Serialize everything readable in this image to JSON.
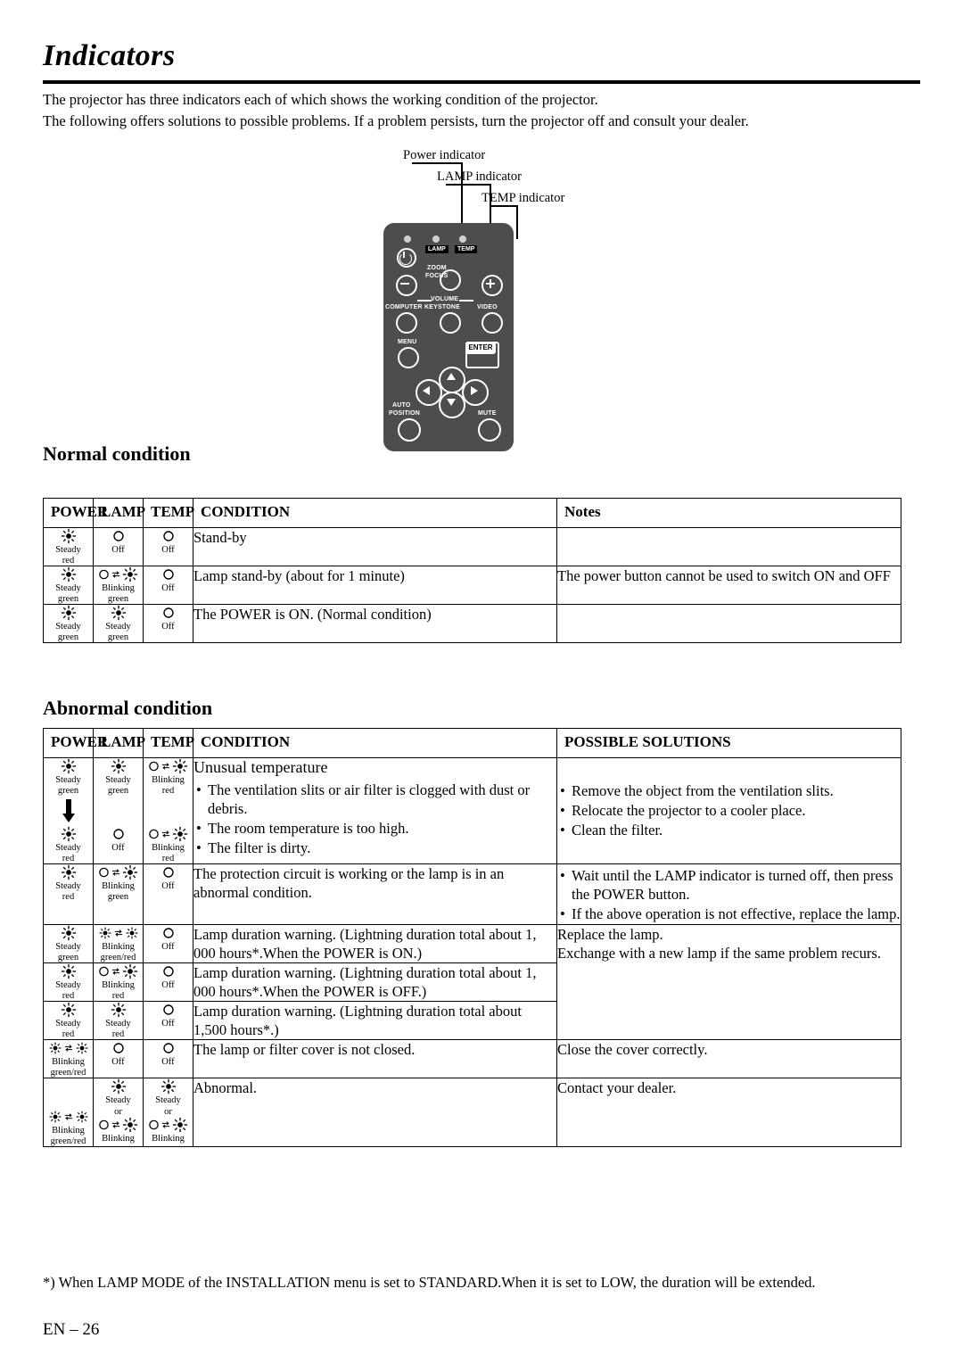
{
  "page": {
    "title": "Indicators",
    "intro_line1": "The projector has three indicators each of which shows the working condition of the projector.",
    "intro_line2": "The following offers solutions to possible problems. If a problem persists, turn the projector off and consult your dealer.",
    "footnote": "*) When LAMP MODE of the INSTALLATION menu is set to STANDARD.When it is set to LOW, the duration will be extended.",
    "page_number": "EN – 26"
  },
  "diagram": {
    "callouts": [
      "Power indicator",
      "LAMP indicator",
      "TEMP indicator"
    ],
    "remote_labels": {
      "lamp": "LAMP",
      "temp": "TEMP",
      "zoom": "ZOOM",
      "focus": "FOCUS",
      "volume": "VOLUME",
      "computer": "COMPUTER",
      "keystone": "KEYSTONE",
      "video": "VIDEO",
      "menu": "MENU",
      "enter": "ENTER",
      "auto": "AUTO",
      "position": "POSITION",
      "mute": "MUTE"
    }
  },
  "sections": {
    "normal": {
      "heading": "Normal condition",
      "columns": [
        "POWER",
        "LAMP",
        "TEMP",
        "CONDITION",
        "Notes"
      ],
      "rows": [
        {
          "power": {
            "icons": [
              "steady"
            ],
            "label": "Steady\nred"
          },
          "lamp": {
            "icons": [
              "off"
            ],
            "label": "Off"
          },
          "temp": {
            "icons": [
              "off"
            ],
            "label": "Off"
          },
          "condition": "Stand-by",
          "notes": ""
        },
        {
          "power": {
            "icons": [
              "steady"
            ],
            "label": "Steady\ngreen"
          },
          "lamp": {
            "icons": [
              "blink"
            ],
            "label": "Blinking\ngreen"
          },
          "temp": {
            "icons": [
              "off"
            ],
            "label": "Off"
          },
          "condition": "Lamp stand-by (about for 1 minute)",
          "notes": "The power button cannot be used to switch ON and OFF"
        },
        {
          "power": {
            "icons": [
              "steady"
            ],
            "label": "Steady\ngreen"
          },
          "lamp": {
            "icons": [
              "steady"
            ],
            "label": "Steady\ngreen"
          },
          "temp": {
            "icons": [
              "off"
            ],
            "label": "Off"
          },
          "condition": "The POWER is ON. (Normal condition)",
          "notes": ""
        }
      ]
    },
    "abnormal": {
      "heading": "Abnormal condition",
      "columns": [
        "POWER",
        "LAMP",
        "TEMP",
        "CONDITION",
        "POSSIBLE SOLUTIONS"
      ],
      "rows": [
        {
          "power": {
            "icons": [
              "steady"
            ],
            "label": "Steady\ngreen",
            "arrow": true,
            "icons2": [
              "steady"
            ],
            "label2": "Steady\nred"
          },
          "lamp": {
            "icons": [
              "steady"
            ],
            "label": "Steady\ngreen",
            "icons2": [
              "off"
            ],
            "label2": "Off"
          },
          "temp": {
            "icons": [
              "blink"
            ],
            "label": "Blinking\nred",
            "icons2": [
              "blink"
            ],
            "label2": "Blinking\nred"
          },
          "condition_title": "Unusual temperature",
          "condition_bullets": [
            "The ventilation slits or air filter is clogged with dust or debris.",
            "The room temperature is too high.",
            "The filter is dirty."
          ],
          "solution_bullets": [
            "Remove the object from the ventilation slits.",
            "Relocate the projector to a cooler place.",
            "Clean the filter."
          ]
        },
        {
          "power": {
            "icons": [
              "steady"
            ],
            "label": "Steady\nred"
          },
          "lamp": {
            "icons": [
              "blink"
            ],
            "label": "Blinking\ngreen"
          },
          "temp": {
            "icons": [
              "off"
            ],
            "label": "Off"
          },
          "condition": "The protection circuit is working or the lamp is in an abnormal condition.",
          "solution_bullets": [
            "Wait until the LAMP indicator is turned off, then press the POWER button.",
            "If the above operation is not effective, replace the lamp."
          ]
        },
        {
          "power": {
            "icons": [
              "steady"
            ],
            "label": "Steady\ngreen"
          },
          "lamp": {
            "icons": [
              "blink2"
            ],
            "label": "Blinking\ngreen/red"
          },
          "temp": {
            "icons": [
              "off"
            ],
            "label": "Off"
          },
          "condition": "Lamp duration warning. (Lightning duration total about 1, 000 hours*.When the POWER is ON.)",
          "notes_group": "Replace the lamp.\nExchange with a new lamp if the same problem recurs."
        },
        {
          "power": {
            "icons": [
              "steady"
            ],
            "label": "Steady\nred"
          },
          "lamp": {
            "icons": [
              "blink"
            ],
            "label": "Blinking\nred"
          },
          "temp": {
            "icons": [
              "off"
            ],
            "label": "Off"
          },
          "condition": "Lamp duration warning. (Lightning duration total about 1, 000 hours*.When the POWER is OFF.)"
        },
        {
          "power": {
            "icons": [
              "steady"
            ],
            "label": "Steady\nred"
          },
          "lamp": {
            "icons": [
              "steady"
            ],
            "label": "Steady\nred"
          },
          "temp": {
            "icons": [
              "off"
            ],
            "label": "Off"
          },
          "condition": "Lamp duration warning. (Lightning duration total about 1,500 hours*.)"
        },
        {
          "power": {
            "icons": [
              "blink2"
            ],
            "label": "Blinking\ngreen/red"
          },
          "lamp": {
            "icons": [
              "off"
            ],
            "label": "Off"
          },
          "temp": {
            "icons": [
              "off"
            ],
            "label": "Off"
          },
          "condition": "The lamp or filter cover is not closed.",
          "notes": "Close the cover correctly."
        },
        {
          "power": {
            "icons": [
              "blink2"
            ],
            "label": "Blinking\ngreen/red"
          },
          "lamp": {
            "icons": [
              "steady"
            ],
            "label": "Steady",
            "or": "or",
            "icons2": [
              "blink"
            ],
            "label2": "Blinking"
          },
          "temp": {
            "icons": [
              "steady"
            ],
            "label": "Steady",
            "or": "or",
            "icons2": [
              "blink"
            ],
            "label2": "Blinking"
          },
          "condition": "Abnormal.",
          "notes": "Contact your dealer."
        }
      ]
    }
  }
}
